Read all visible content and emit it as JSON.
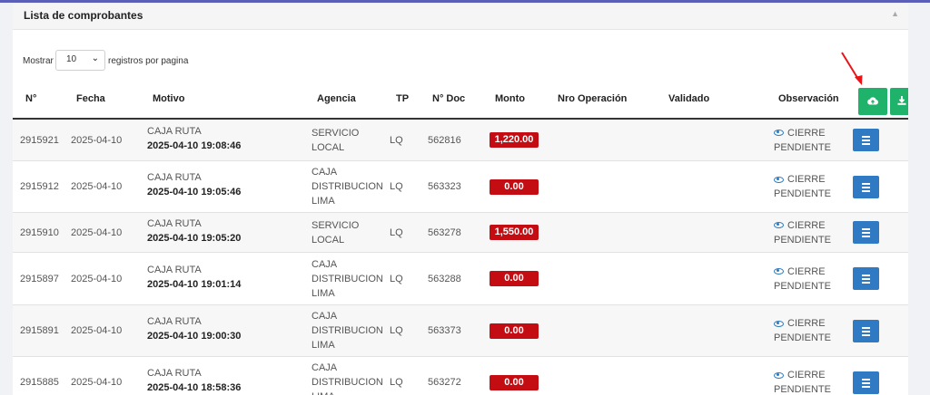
{
  "panel": {
    "title": "Lista de comprobantes"
  },
  "pagination": {
    "show_label": "Mostrar",
    "per_page": "10",
    "suffix_label": "registros por pagina"
  },
  "columns": [
    "N°",
    "Fecha",
    "Motivo",
    "Agencia",
    "TP",
    "N° Doc",
    "Monto",
    "Nro Operación",
    "Validado",
    "Observación"
  ],
  "rows": [
    {
      "id": "2915921",
      "fecha": "2025-04-10",
      "motivo": "CAJA RUTA",
      "datetime": "2025-04-10 19:08:46",
      "agencia": [
        "SERVICIO",
        "LOCAL"
      ],
      "tp": "LQ",
      "doc": "562816",
      "monto": "1,220.00",
      "obs": [
        "CIERRE",
        "PENDIENTE"
      ]
    },
    {
      "id": "2915912",
      "fecha": "2025-04-10",
      "motivo": "CAJA RUTA",
      "datetime": "2025-04-10 19:05:46",
      "agencia": [
        "CAJA",
        "DISTRIBUCION",
        "LIMA"
      ],
      "tp": "LQ",
      "doc": "563323",
      "monto": "0.00",
      "obs": [
        "CIERRE",
        "PENDIENTE"
      ]
    },
    {
      "id": "2915910",
      "fecha": "2025-04-10",
      "motivo": "CAJA RUTA",
      "datetime": "2025-04-10 19:05:20",
      "agencia": [
        "SERVICIO",
        "LOCAL"
      ],
      "tp": "LQ",
      "doc": "563278",
      "monto": "1,550.00",
      "obs": [
        "CIERRE",
        "PENDIENTE"
      ]
    },
    {
      "id": "2915897",
      "fecha": "2025-04-10",
      "motivo": "CAJA RUTA",
      "datetime": "2025-04-10 19:01:14",
      "agencia": [
        "CAJA",
        "DISTRIBUCION",
        "LIMA"
      ],
      "tp": "LQ",
      "doc": "563288",
      "monto": "0.00",
      "obs": [
        "CIERRE",
        "PENDIENTE"
      ]
    },
    {
      "id": "2915891",
      "fecha": "2025-04-10",
      "motivo": "CAJA RUTA",
      "datetime": "2025-04-10 19:00:30",
      "agencia": [
        "CAJA",
        "DISTRIBUCION",
        "LIMA"
      ],
      "tp": "LQ",
      "doc": "563373",
      "monto": "0.00",
      "obs": [
        "CIERRE",
        "PENDIENTE"
      ]
    },
    {
      "id": "2915885",
      "fecha": "2025-04-10",
      "motivo": "CAJA RUTA",
      "datetime": "2025-04-10 18:58:36",
      "agencia": [
        "CAJA",
        "DISTRIBUCION",
        "LIMA"
      ],
      "tp": "LQ",
      "doc": "563272",
      "monto": "0.00",
      "obs": [
        "CIERRE",
        "PENDIENTE"
      ]
    }
  ],
  "icons": {
    "upload": "cloud-upload-icon",
    "download": "download-icon",
    "menu": "menu-icon",
    "eye": "eye-icon",
    "collapse": "chevron-up-icon"
  },
  "colors": {
    "monto_red": "#c40d13",
    "action_green": "#1fb26b",
    "menu_blue": "#2f7ac3",
    "arrow_red": "#e8141a"
  }
}
